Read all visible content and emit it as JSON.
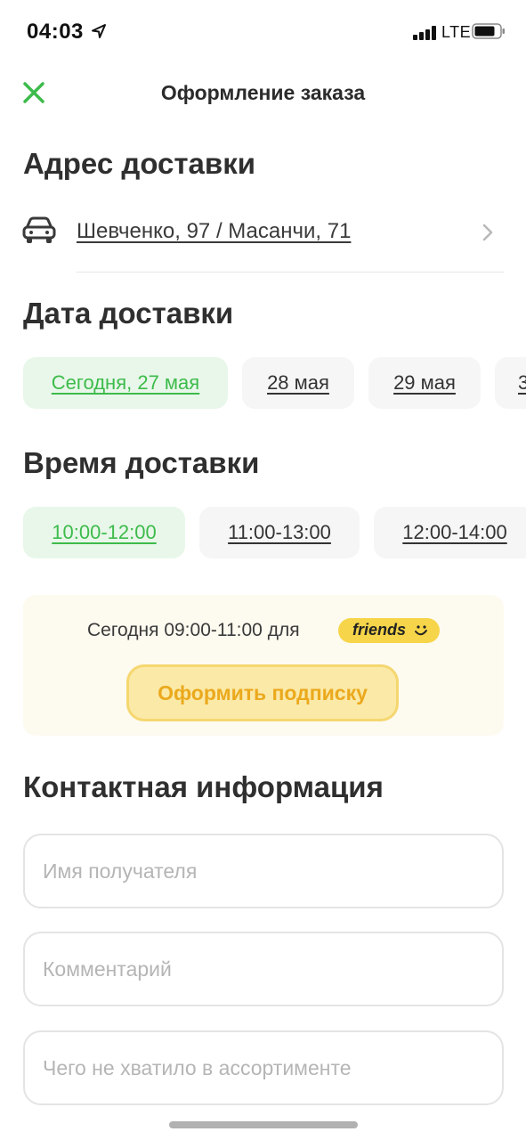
{
  "status_bar": {
    "time": "04:03",
    "network": "LTE"
  },
  "nav": {
    "title": "Оформление заказа"
  },
  "address": {
    "section_title": "Адрес доставки",
    "text": "Шевченко, 97 / Масанчи, 71"
  },
  "date": {
    "section_title": "Дата доставки",
    "options": [
      {
        "label": "Сегодня, 27 мая",
        "selected": true
      },
      {
        "label": "28 мая",
        "selected": false
      },
      {
        "label": "29 мая",
        "selected": false
      },
      {
        "label": "3",
        "selected": false
      }
    ]
  },
  "time": {
    "section_title": "Время доставки",
    "options": [
      {
        "label": "10:00-12:00",
        "selected": true
      },
      {
        "label": "11:00-13:00",
        "selected": false
      },
      {
        "label": "12:00-14:00",
        "selected": false
      }
    ]
  },
  "promo": {
    "text": "Сегодня 09:00-11:00 для",
    "badge": "friends",
    "button": "Оформить подписку"
  },
  "contact": {
    "section_title": "Контактная информация",
    "fields": [
      {
        "placeholder": "Имя получателя",
        "value": ""
      },
      {
        "placeholder": "Комментарий",
        "value": ""
      },
      {
        "placeholder": "Чего не хватило в ассортименте",
        "value": ""
      }
    ]
  },
  "colors": {
    "accent_green": "#3dbb4b",
    "selected_bg": "#e8f7e9",
    "promo_yellow": "#f7d54a",
    "promo_button_text": "#eba91d"
  },
  "icons": [
    "location-arrow-icon",
    "signal-icon",
    "battery-icon",
    "close-icon",
    "car-icon",
    "chevron-right-icon",
    "smile-icon"
  ]
}
